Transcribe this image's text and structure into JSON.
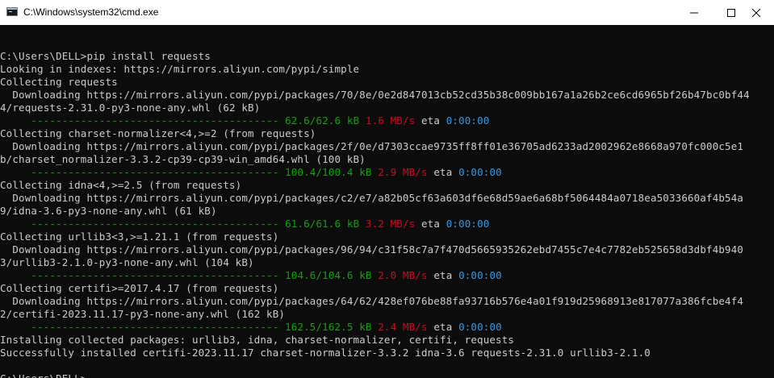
{
  "window": {
    "title": "C:\\Windows\\system32\\cmd.exe"
  },
  "console": {
    "lines": [
      {
        "type": "text",
        "text": ""
      },
      {
        "type": "text",
        "text": "C:\\Users\\DELL>pip install requests"
      },
      {
        "type": "text",
        "text": "Looking in indexes: https://mirrors.aliyun.com/pypi/simple"
      },
      {
        "type": "text",
        "text": "Collecting requests"
      },
      {
        "type": "text",
        "text": "  Downloading https://mirrors.aliyun.com/pypi/packages/70/8e/0e2d847013cb52cd35b38c009bb167a1a26b2ce6cd6965bf26b47bc0bf44"
      },
      {
        "type": "text",
        "text": "4/requests-2.31.0-py3-none-any.whl (62 kB)"
      },
      {
        "type": "progress",
        "bar": "     ---------------------------------------- ",
        "done": "62.6/62.6 kB",
        "speed": "1.6 MB/s",
        "eta_label": "eta",
        "eta": "0:00:00"
      },
      {
        "type": "text",
        "text": "Collecting charset-normalizer<4,>=2 (from requests)"
      },
      {
        "type": "text",
        "text": "  Downloading https://mirrors.aliyun.com/pypi/packages/2f/0e/d7303ccae9735ff8ff01e36705ad6233ad2002962e8668a970fc000c5e1"
      },
      {
        "type": "text",
        "text": "b/charset_normalizer-3.3.2-cp39-cp39-win_amd64.whl (100 kB)"
      },
      {
        "type": "progress",
        "bar": "     ---------------------------------------- ",
        "done": "100.4/100.4 kB",
        "speed": "2.9 MB/s",
        "eta_label": "eta",
        "eta": "0:00:00"
      },
      {
        "type": "text",
        "text": "Collecting idna<4,>=2.5 (from requests)"
      },
      {
        "type": "text",
        "text": "  Downloading https://mirrors.aliyun.com/pypi/packages/c2/e7/a82b05cf63a603df6e68d59ae6a68bf5064484a0718ea5033660af4b54a"
      },
      {
        "type": "text",
        "text": "9/idna-3.6-py3-none-any.whl (61 kB)"
      },
      {
        "type": "progress",
        "bar": "     ---------------------------------------- ",
        "done": "61.6/61.6 kB",
        "speed": "3.2 MB/s",
        "eta_label": "eta",
        "eta": "0:00:00"
      },
      {
        "type": "text",
        "text": "Collecting urllib3<3,>=1.21.1 (from requests)"
      },
      {
        "type": "text",
        "text": "  Downloading https://mirrors.aliyun.com/pypi/packages/96/94/c31f58c7a7f470d5665935262ebd7455c7e4c7782eb525658d3dbf4b940"
      },
      {
        "type": "text",
        "text": "3/urllib3-2.1.0-py3-none-any.whl (104 kB)"
      },
      {
        "type": "progress",
        "bar": "     ---------------------------------------- ",
        "done": "104.6/104.6 kB",
        "speed": "2.0 MB/s",
        "eta_label": "eta",
        "eta": "0:00:00"
      },
      {
        "type": "text",
        "text": "Collecting certifi>=2017.4.17 (from requests)"
      },
      {
        "type": "text",
        "text": "  Downloading https://mirrors.aliyun.com/pypi/packages/64/62/428ef076be88fa93716b576e4a01f919d25968913e817077a386fcbe4f4"
      },
      {
        "type": "text",
        "text": "2/certifi-2023.11.17-py3-none-any.whl (162 kB)"
      },
      {
        "type": "progress",
        "bar": "     ---------------------------------------- ",
        "done": "162.5/162.5 kB",
        "speed": "2.4 MB/s",
        "eta_label": "eta",
        "eta": "0:00:00"
      },
      {
        "type": "text",
        "text": "Installing collected packages: urllib3, idna, charset-normalizer, certifi, requests"
      },
      {
        "type": "text",
        "text": "Successfully installed certifi-2023.11.17 charset-normalizer-3.3.2 idna-3.6 requests-2.31.0 urllib3-2.1.0"
      },
      {
        "type": "text",
        "text": ""
      },
      {
        "type": "text",
        "text": "C:\\Users\\DELL>"
      }
    ]
  }
}
